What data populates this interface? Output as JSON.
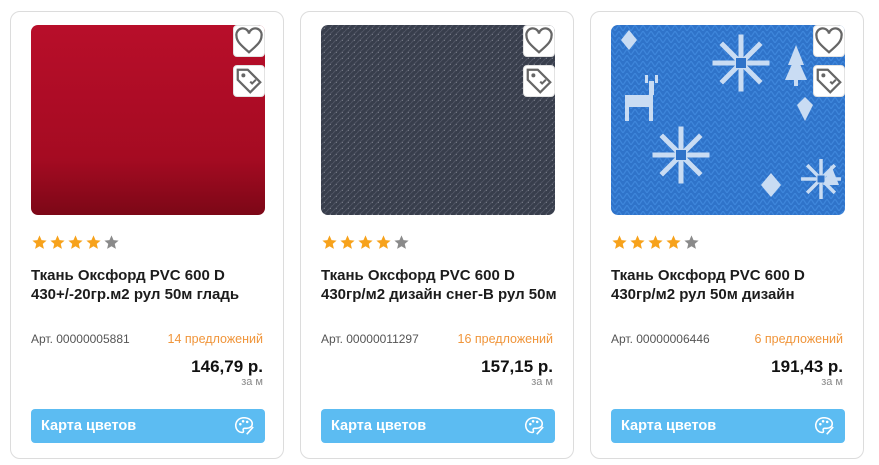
{
  "rating_max": 5,
  "products": [
    {
      "title": "Ткань Оксфорд PVC 600 D 430+/-20гр.м2 рул 50м гладь",
      "article": "Арт. 00000005881",
      "offers": "14 предложений",
      "price": "146,79 р.",
      "unit": "за м",
      "button": "Карта цветов",
      "rating": 4,
      "image_color": "#b0102a"
    },
    {
      "title": "Ткань Оксфорд PVC 600 D 430гр/м2 дизайн снег-В рул 50м",
      "article": "Арт. 00000011297",
      "offers": "16 предложений",
      "price": "157,15 р.",
      "unit": "за м",
      "button": "Карта цветов",
      "rating": 4,
      "image_color": "#3b4150"
    },
    {
      "title": "Ткань Оксфорд PVC 600 D 430гр/м2 рул 50м дизайн",
      "article": "Арт. 00000006446",
      "offers": "6 предложений",
      "price": "191,43 р.",
      "unit": "за м",
      "button": "Карта цветов",
      "rating": 4,
      "image_color": "#2f73c9"
    }
  ],
  "colors": {
    "accent_button": "#5cbcf2",
    "offers_text": "#f0953a",
    "star_filled": "#f7a21b",
    "star_empty": "#8a8a8a"
  }
}
